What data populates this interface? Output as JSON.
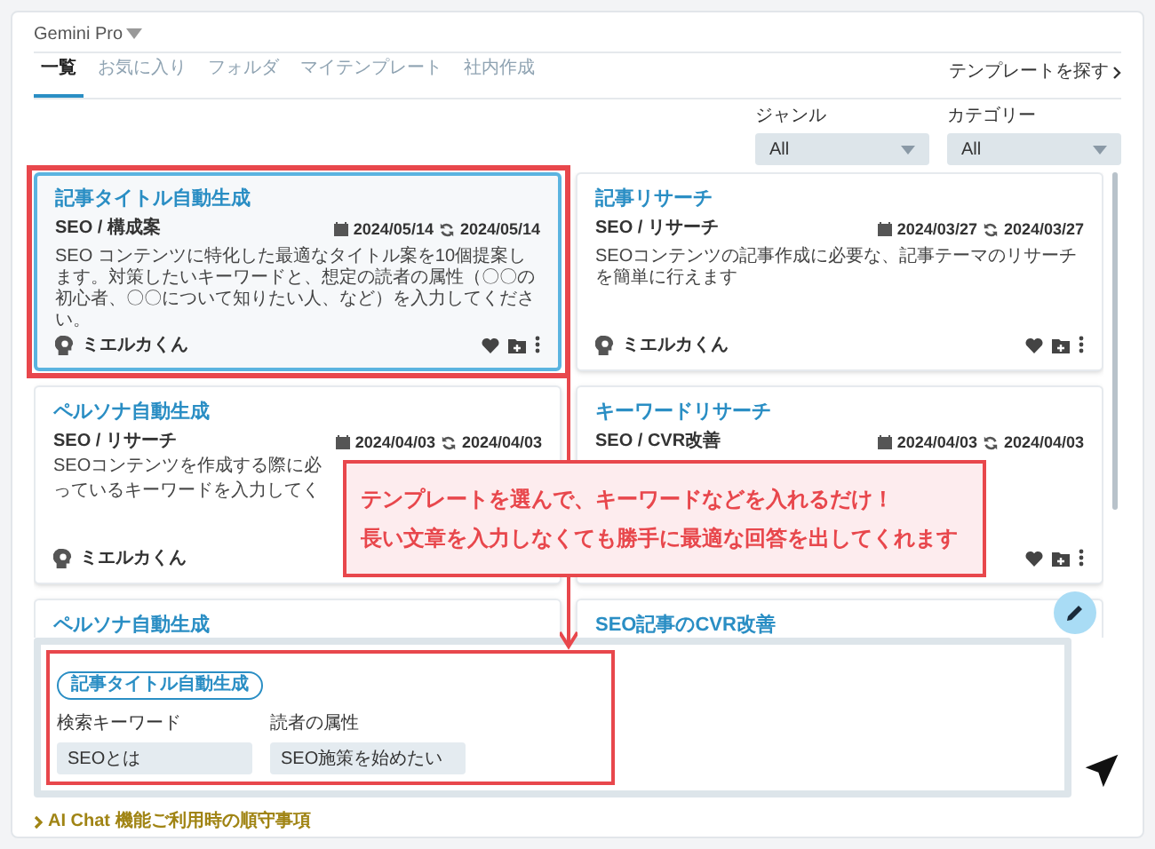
{
  "model_selector": {
    "label": "Gemini Pro"
  },
  "tabs": [
    {
      "label": "一覧",
      "selected": true
    },
    {
      "label": "お気に入り",
      "selected": false
    },
    {
      "label": "フォルダ",
      "selected": false
    },
    {
      "label": "マイテンプレート",
      "selected": false
    },
    {
      "label": "社内作成",
      "selected": false
    }
  ],
  "find_template_link": "テンプレートを探す",
  "filters": [
    {
      "label": "ジャンル",
      "value": "All"
    },
    {
      "label": "カテゴリー",
      "value": "All"
    }
  ],
  "cards": [
    {
      "title": "記事タイトル自動生成",
      "category": "SEO / 構成案",
      "created": "2024/05/14",
      "updated": "2024/05/14",
      "description": "SEO コンテンツに特化した最適なタイトル案を10個提案します。対策したいキーワードと、想定の読者の属性（〇〇の初心者、〇〇について知りたい人、など）を入力してください。",
      "author": "ミエルカくん",
      "actions_visible": true,
      "selected": true
    },
    {
      "title": "記事リサーチ",
      "category": "SEO / リサーチ",
      "created": "2024/03/27",
      "updated": "2024/03/27",
      "description": "SEOコンテンツの記事作成に必要な、記事テーマのリサーチを簡単に行えます",
      "author": "ミエルカくん",
      "actions_visible": true,
      "selected": false
    },
    {
      "title": "ペルソナ自動生成",
      "category": "SEO / リサーチ",
      "created": "2024/04/03",
      "updated": "2024/04/03",
      "description_lines": [
        "SEOコンテンツを作成する際に必",
        "っているキーワードを入力してく"
      ],
      "author": "ミエルカくん",
      "selected": false
    },
    {
      "title": "キーワードリサーチ",
      "category": "SEO / CVR改善",
      "created": "2024/04/03",
      "updated": "2024/04/03",
      "actions_visible": true,
      "selected": false
    },
    {
      "title": "ペルソナ自動生成",
      "selected": false
    },
    {
      "title": "SEO記事のCVR改善",
      "selected": false
    }
  ],
  "callout": {
    "lines": [
      "テンプレートを選んで、キーワードなどを入れるだけ！",
      "長い文章を入力しなくても勝手に最適な回答を出してくれます"
    ]
  },
  "chat_input": {
    "template_chip": "記事タイトル自動生成",
    "fields": [
      {
        "label": "検索キーワード",
        "value": "SEOとは"
      },
      {
        "label": "読者の属性",
        "value": "SEO施策を始めたい"
      }
    ]
  },
  "footer_link": "AI Chat 機能ご利用時の順守事項"
}
